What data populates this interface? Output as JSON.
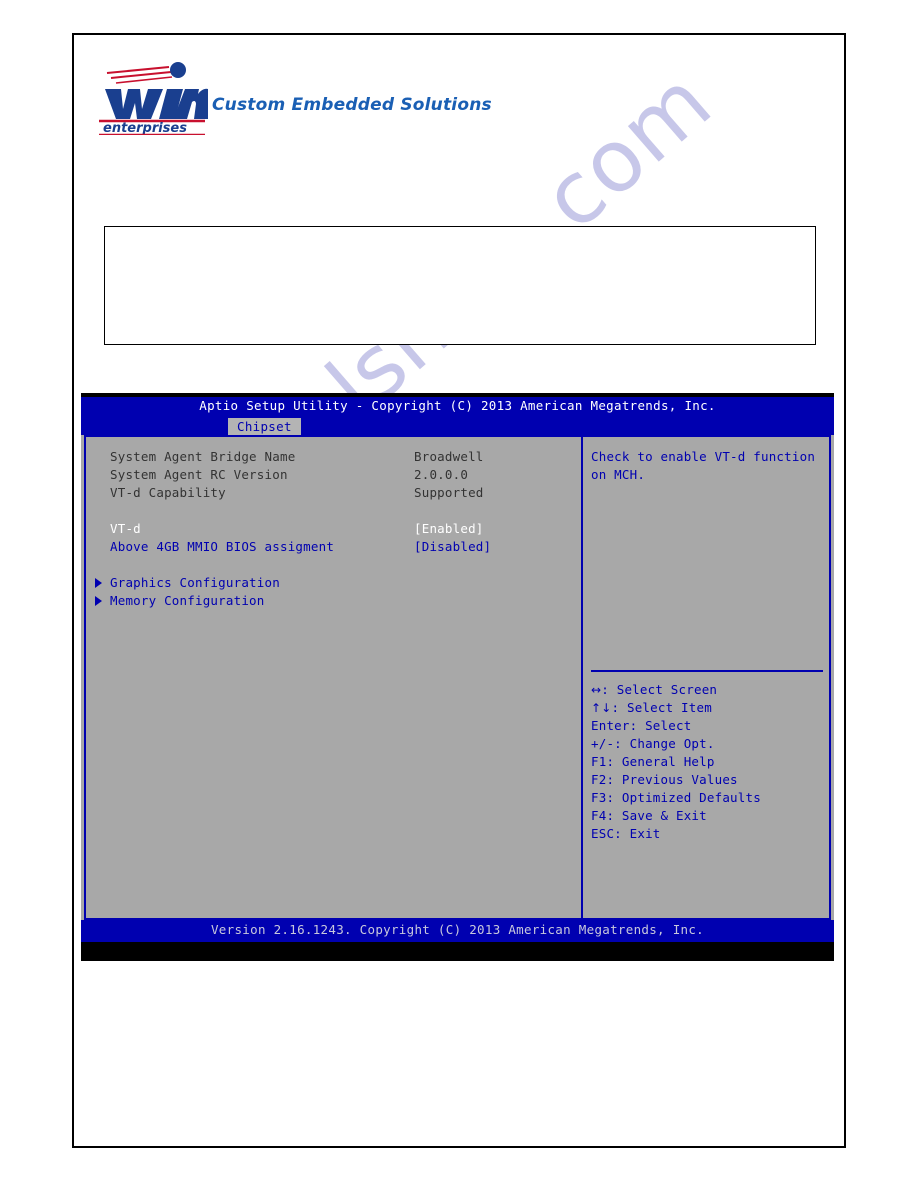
{
  "header": {
    "logo_word": "win",
    "logo_sub": "enterprises",
    "tagline": "Custom Embedded Solutions"
  },
  "watermark": {
    "text": "manualshive.com"
  },
  "content_box": {
    "text": ""
  },
  "bios": {
    "title": "Aptio Setup Utility - Copyright (C) 2013 American Megatrends, Inc.",
    "active_tab": "Chipset",
    "rows": [
      {
        "label": "System Agent Bridge Name",
        "value": "Broadwell",
        "label_color": "info",
        "value_color": "info",
        "type": "info"
      },
      {
        "label": "System Agent RC Version",
        "value": "2.0.0.0",
        "label_color": "info",
        "value_color": "info",
        "type": "info"
      },
      {
        "label": "VT-d Capability",
        "value": "Supported",
        "label_color": "info",
        "value_color": "info",
        "type": "info"
      },
      {
        "label": "",
        "value": "",
        "label_color": "info",
        "value_color": "info",
        "type": "spacer"
      },
      {
        "label": "VT-d",
        "value": "[Enabled]",
        "label_color": "white",
        "value_color": "white",
        "type": "option"
      },
      {
        "label": "Above 4GB MMIO BIOS assigment",
        "value": "[Disabled]",
        "label_color": "blue",
        "value_color": "blue",
        "type": "option"
      }
    ],
    "submenus": [
      {
        "label": "Graphics Configuration"
      },
      {
        "label": "Memory Configuration"
      }
    ],
    "help_text": "Check to enable VT-d function on MCH.",
    "key_legend": [
      {
        "glyph": "↔",
        "text": ": Select Screen"
      },
      {
        "glyph": "↑↓",
        "text": ": Select Item"
      },
      {
        "glyph": "",
        "text": "Enter: Select"
      },
      {
        "glyph": "",
        "text": "+/-: Change Opt."
      },
      {
        "glyph": "",
        "text": "F1: General Help"
      },
      {
        "glyph": "",
        "text": "F2: Previous Values"
      },
      {
        "glyph": "",
        "text": "F3: Optimized Defaults"
      },
      {
        "glyph": "",
        "text": "F4: Save & Exit"
      },
      {
        "glyph": "",
        "text": "ESC: Exit"
      }
    ],
    "footer": "Version 2.16.1243. Copyright (C) 2013 American Megatrends, Inc."
  },
  "colors": {
    "bios_blue": "#0000b0",
    "bios_gray": "#a8a8a8",
    "tab_gray": "#b4b4b4",
    "brand_blue": "#1a5fb4",
    "brand_red": "#c8102e",
    "watermark": "#9b9bd8"
  }
}
